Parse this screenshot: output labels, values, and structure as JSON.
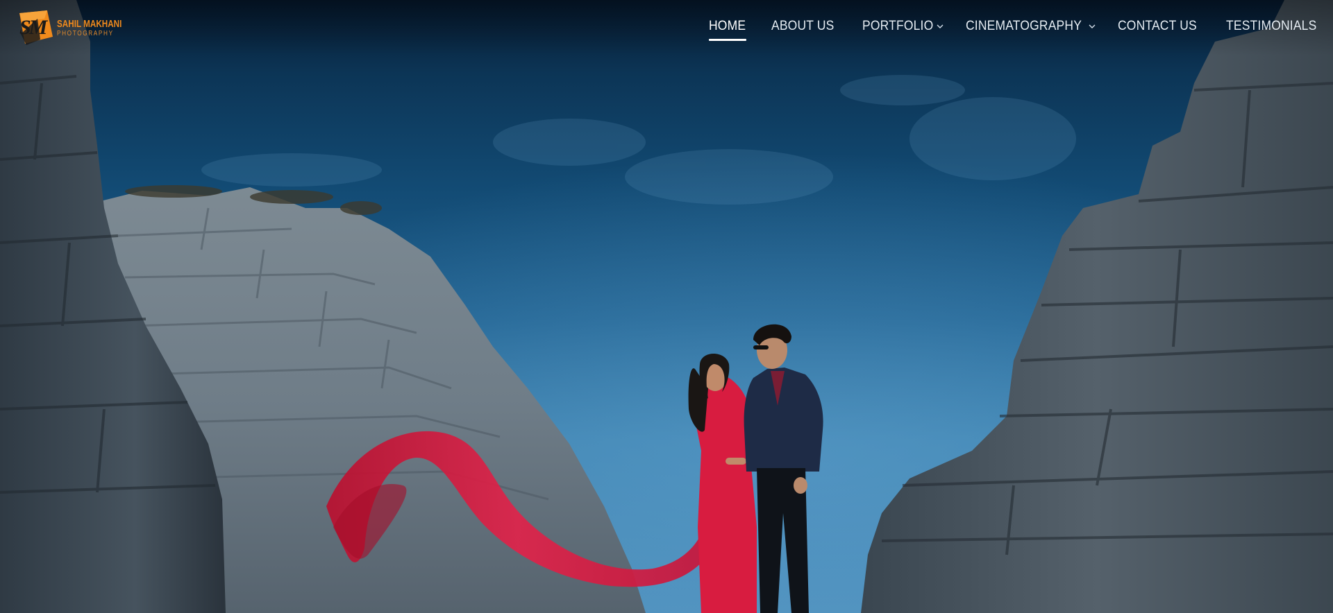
{
  "brand": {
    "logo_monogram": "SM",
    "name": "SAHIL MAKHANI",
    "tagline": "PHOTOGRAPHY",
    "accent_color": "#f08a1c"
  },
  "nav": {
    "items": [
      {
        "label": "HOME",
        "active": true,
        "has_dropdown": false
      },
      {
        "label": "ABOUT US",
        "active": false,
        "has_dropdown": false
      },
      {
        "label": "PORTFOLIO",
        "active": false,
        "has_dropdown": true
      },
      {
        "label": "CINEMATOGRAPHY",
        "active": false,
        "has_dropdown": true
      },
      {
        "label": "CONTACT US",
        "active": false,
        "has_dropdown": false
      },
      {
        "label": "TESTIMONIALS",
        "active": false,
        "has_dropdown": false
      }
    ],
    "dropdown_icon": "chevron-down-icon",
    "text_color": "#e6edf3"
  },
  "hero": {
    "image_subject": "couple in red dress and navy suit between rock cliffs under blue sky",
    "dress_color": "#d7193f",
    "sky_color": "#1f6190",
    "rock_color": "#4a5560"
  }
}
